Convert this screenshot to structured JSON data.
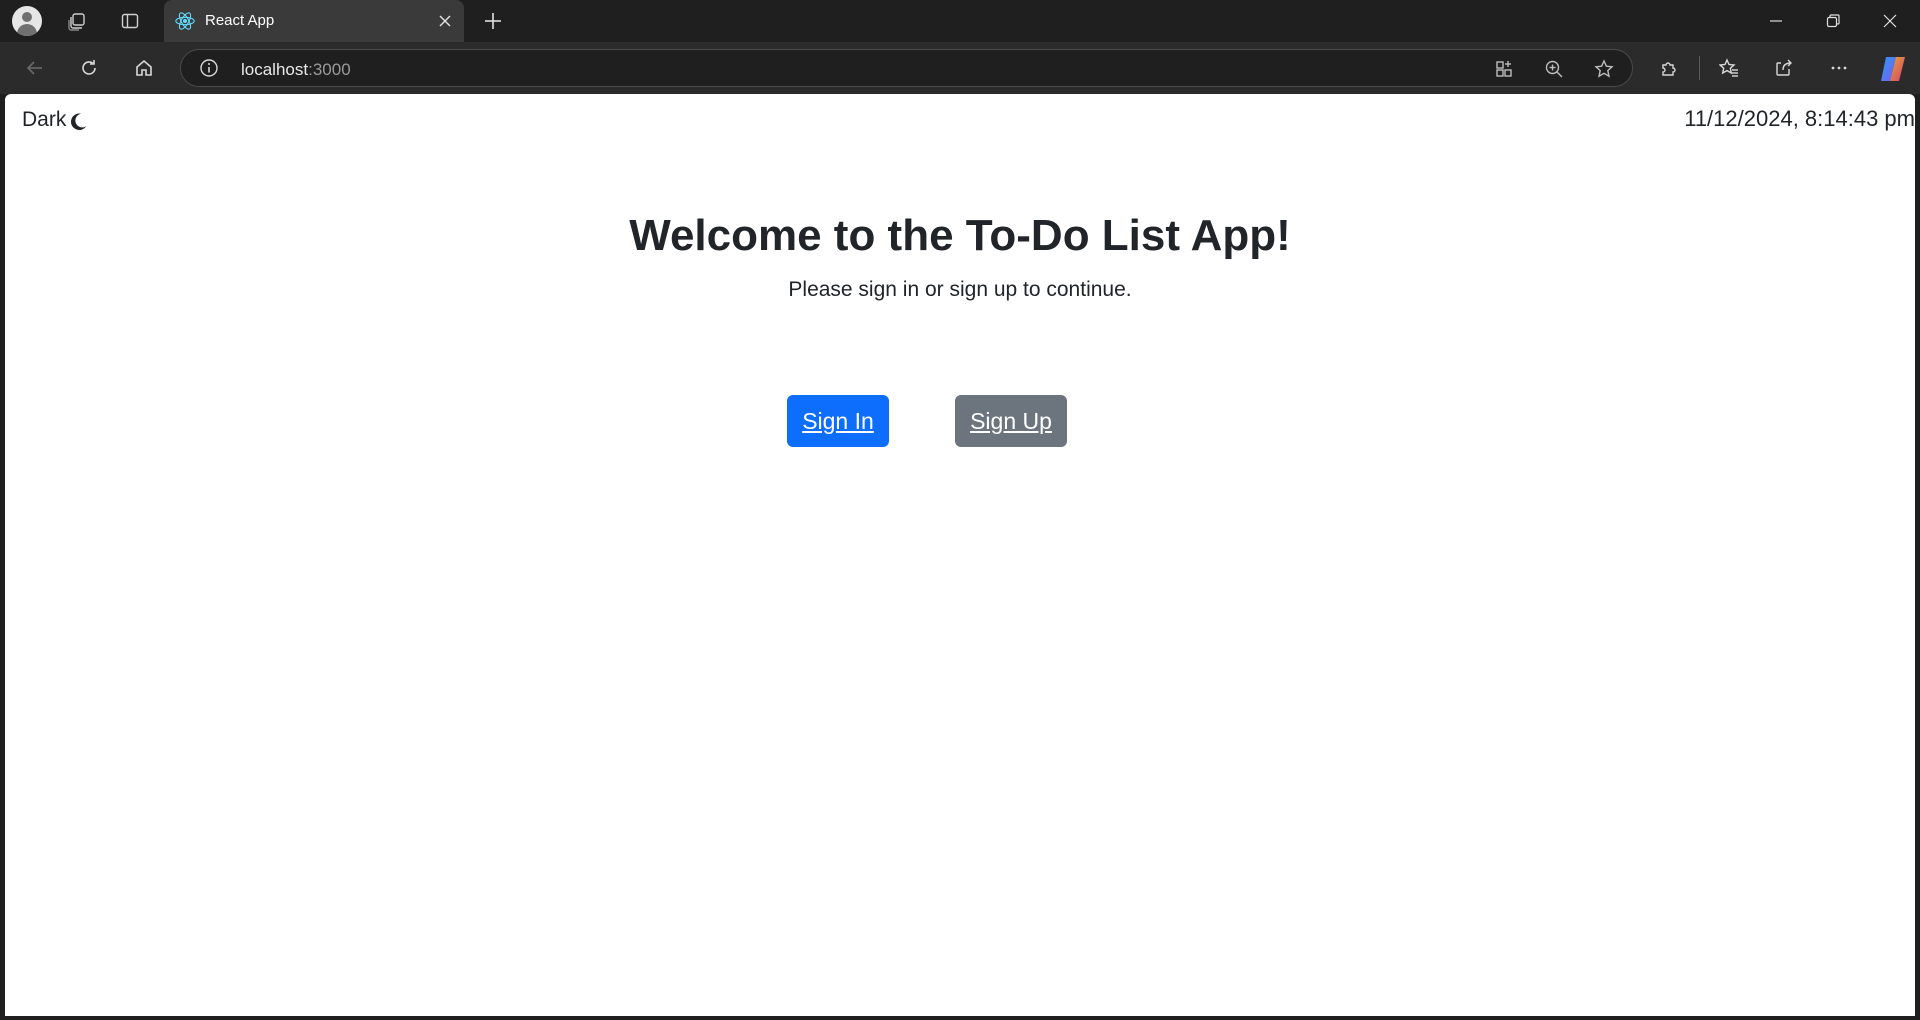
{
  "browser": {
    "tab": {
      "title": "React App",
      "favicon": "react-logo-icon"
    },
    "address_bar": {
      "host": "localhost",
      "port": ":3000"
    },
    "colors": {
      "chrome_bg": "#1f1f1f",
      "toolbar_bg": "#2b2b2b",
      "tab_active": "#3a3a3a"
    }
  },
  "page": {
    "theme_toggle": {
      "label": "Dark",
      "icon": "moon-icon"
    },
    "clock": "11/12/2024, 8:14:43 pm",
    "heading": "Welcome to the To-Do List App!",
    "subtext": "Please sign in or sign up to continue.",
    "buttons": {
      "sign_in": {
        "label": "Sign In",
        "color": "#0d6efd"
      },
      "sign_up": {
        "label": "Sign Up",
        "color": "#6c757d"
      }
    }
  }
}
